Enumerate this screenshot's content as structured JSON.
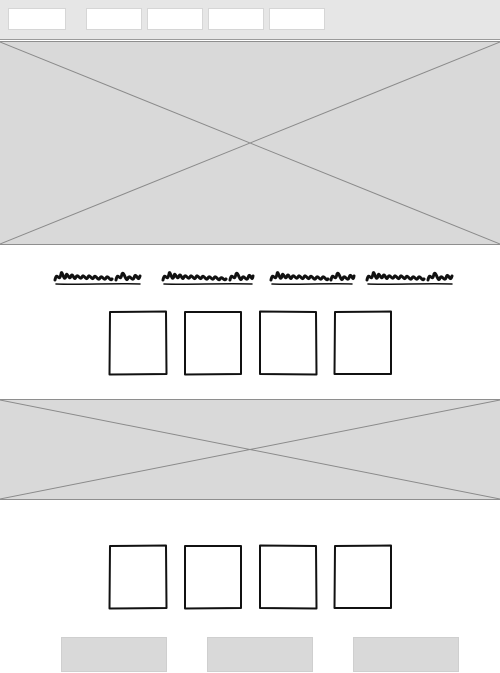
{
  "navigation": {
    "items": [
      "",
      "",
      "",
      "",
      ""
    ]
  },
  "hero_image": {
    "icon": "image-placeholder-icon"
  },
  "feature_labels": [
    "",
    "",
    "",
    ""
  ],
  "feature_tiles_row_1": [
    "",
    "",
    "",
    ""
  ],
  "banner_image": {
    "icon": "image-placeholder-icon"
  },
  "feature_tiles_row_2": [
    "",
    "",
    "",
    ""
  ],
  "footer_buttons": [
    "",
    "",
    ""
  ],
  "colors": {
    "placeholder_fill": "#d9d9d9",
    "nav_background": "#e6e6e6",
    "ink": "#111111"
  }
}
